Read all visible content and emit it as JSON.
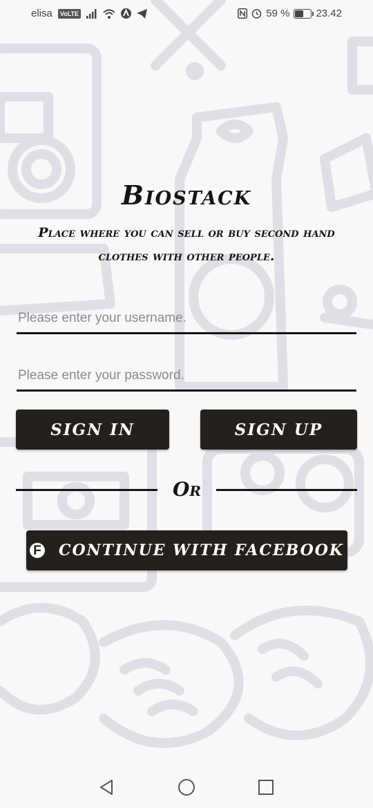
{
  "status_bar": {
    "carrier": "elisa",
    "volte": "VoLTE",
    "battery": "59 %",
    "battery_level": 0.59,
    "time": "23.42",
    "icons": [
      "signal-icon",
      "wifi-icon",
      "nav-app-icon",
      "telegram-icon",
      "nfc-icon",
      "alarm-icon",
      "battery-icon"
    ]
  },
  "app": {
    "title": "Biostack",
    "subtitle": "Place where you can sell or buy second hand clothes with other people."
  },
  "form": {
    "username_placeholder": "Please enter your username.",
    "password_placeholder": "Please enter your password."
  },
  "buttons": {
    "sign_in": "Sign In",
    "sign_up": "Sign Up",
    "or": "Or",
    "facebook": "Continue with Facebook"
  },
  "nav_bar": {
    "icons": [
      "back-icon",
      "home-icon",
      "recent-apps-icon"
    ]
  },
  "colors": {
    "background": "#f8f8f8",
    "button": "#23201d",
    "text": "#161412",
    "doodle": "#dddde3"
  }
}
